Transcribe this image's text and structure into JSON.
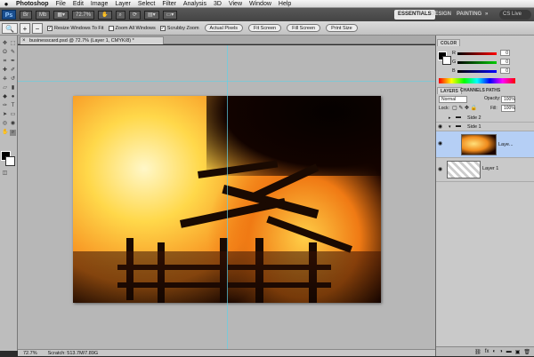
{
  "menubar": {
    "apple": "",
    "app": "Photoshop",
    "items": [
      "File",
      "Edit",
      "Image",
      "Layer",
      "Select",
      "Filter",
      "Analysis",
      "3D",
      "View",
      "Window",
      "Help"
    ]
  },
  "appbar": {
    "logo": "Ps",
    "zoom": "72.7%",
    "workspaces": [
      "ESSENTIALS",
      "DESIGN",
      "PAINTING"
    ],
    "more": "»",
    "search": "CS Live"
  },
  "options": {
    "resize_window": "Resize Windows To Fit",
    "zoom_all": "Zoom All Windows",
    "scrubby": "Scrubby Zoom",
    "actual_pixels": "Actual Pixels",
    "fit_screen": "Fit Screen",
    "fill_screen": "Fill Screen",
    "print_size": "Print Size"
  },
  "document": {
    "tab_title": "businesscard.psd @ 72.7% (Layer 1, CMYK/8) *",
    "close": "×"
  },
  "status": {
    "zoom": "72.7%",
    "info": "Scratch: 513.7M/7.89G"
  },
  "panels": {
    "color_tab": "COLOR",
    "labels": [
      "R",
      "G",
      "B"
    ],
    "values": [
      "0",
      "0",
      "0"
    ],
    "layers_tabs": [
      "LAYERS",
      "CHANNELS",
      "PATHS"
    ],
    "blend_mode": "Normal",
    "opacity_label": "Opacity:",
    "opacity": "100%",
    "lock_label": "Lock:",
    "fill_label": "Fill:",
    "fill": "100%",
    "layers": [
      "Side 2",
      "Side 1",
      "Laye...",
      "Layer 1"
    ]
  },
  "colors": {
    "guide": "#5fd0e6",
    "selected_layer": "#b5cff5"
  }
}
